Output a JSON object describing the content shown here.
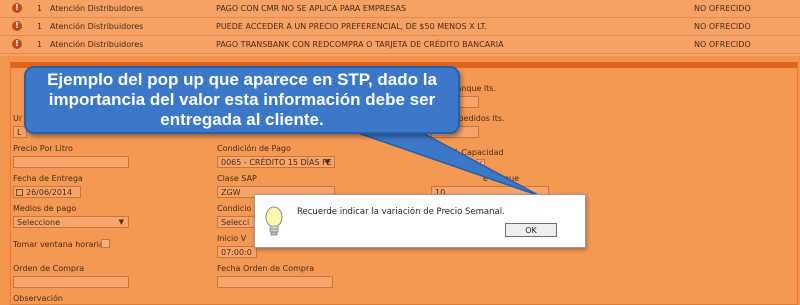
{
  "table": {
    "rows": [
      {
        "warn": "!",
        "num": "1",
        "type": "Atención Distribuidores",
        "description": "PAGO CON CMR NO SE APLICA PARA EMPRESAS",
        "status": "NO OFRECIDO"
      },
      {
        "warn": "!",
        "num": "1",
        "type": "Atención Distribuidores",
        "description": "PUEDE ACCEDER A UN PRECIO PREFERENCIAL, DE $50 MENOS X LT.",
        "status": "NO OFRECIDO"
      },
      {
        "warn": "!",
        "num": "1",
        "type": "Atención Distribuidores",
        "description": "PAGO TRANSBANK CON REDCOMPRA O TARJETA DE CRÉDITO BANCARIA",
        "status": "NO OFRECIDO"
      }
    ]
  },
  "form": {
    "capacidad_label": "cidad del Estanque lts.",
    "promedio_label": "edio útimos pedidos lts.",
    "un_label": "Ur",
    "l_value": "L",
    "precio_label": "Precio Por Litro",
    "condicion_pago_label": "Condición de Pago",
    "condicion_pago_value": "0065 - CRÉDITO 15 DÍAS FE",
    "modif_capacidad_label": "Modif. Capacidad",
    "modif_check": "✓",
    "fecha_entrega_label": "Fecha de Entrega",
    "fecha_entrega_value": "26/06/2014",
    "clase_sap_label": "Clase SAP",
    "clase_sap_value": "ZGW",
    "tanque_label": "e Tanque",
    "tanque_value": "10",
    "medios_pago_label": "Medios de pago",
    "medios_pago_value": "Seleccione",
    "condicion2_label": "Condicio",
    "condicion2_value": "Selecci",
    "tomar_ventana_label": "Tomar ventana horaria",
    "inicio_label": "Inicio V",
    "inicio_value": "07:00:0",
    "orden_compra_label": "Orden de Compra",
    "fecha_orden_label": "Fecha Orden de Compra",
    "observacion_label": "Observación"
  },
  "callout": {
    "text": "Ejemplo del pop up que aparece en STP, dado la importancia del valor esta información debe ser entregada al cliente."
  },
  "dialog": {
    "message": "Recuerde indicar la variación de Precio Semanal.",
    "ok_label": "OK",
    "icon": "lightbulb-icon"
  },
  "colors": {
    "background": "#f4934e",
    "callout": "#3c78c8",
    "header_bar": "#e0641c"
  }
}
